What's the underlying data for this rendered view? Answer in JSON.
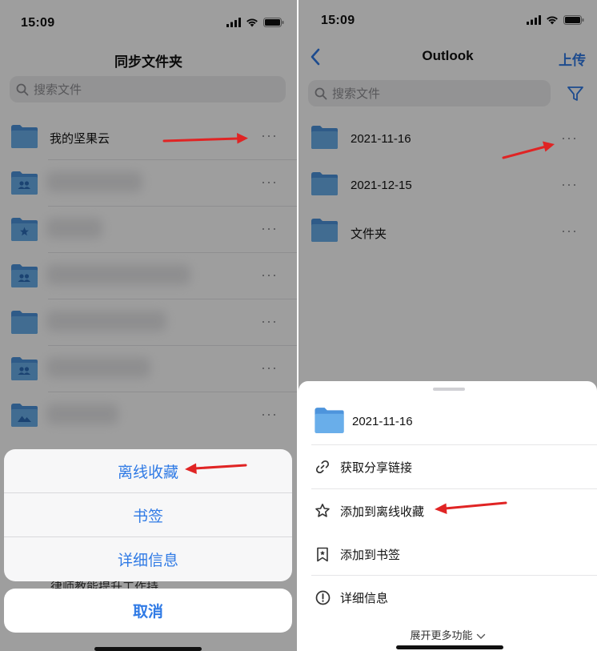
{
  "left": {
    "status_time": "15:09",
    "title": "同步文件夹",
    "search_placeholder": "搜索文件",
    "first_folder_name": "我的坚果云",
    "more_glyph": "···",
    "action_sheet": [
      "离线收藏",
      "书签",
      "详细信息"
    ],
    "peek_text": "律师教能提升工作持",
    "cancel_label": "取消"
  },
  "right": {
    "status_time": "15:09",
    "title": "Outlook",
    "upload_label": "上传",
    "search_placeholder": "搜索文件",
    "folders": [
      "2021-11-16",
      "2021-12-15",
      "文件夹"
    ],
    "more_glyph": "···",
    "sheet": {
      "header_name": "2021-11-16",
      "items": [
        {
          "label": "获取分享链接",
          "icon": "link-icon"
        },
        {
          "label": "添加到离线收藏",
          "icon": "star-icon"
        },
        {
          "label": "添加到书签",
          "icon": "bookmark-icon"
        },
        {
          "label": "详细信息",
          "icon": "info-icon"
        }
      ],
      "expand_label": "展开更多功能"
    }
  },
  "colors": {
    "accent": "#2f7ae5",
    "folder": "#5aa3e6",
    "folder_dark": "#3f86d0",
    "annotation_arrow": "#e02424"
  }
}
